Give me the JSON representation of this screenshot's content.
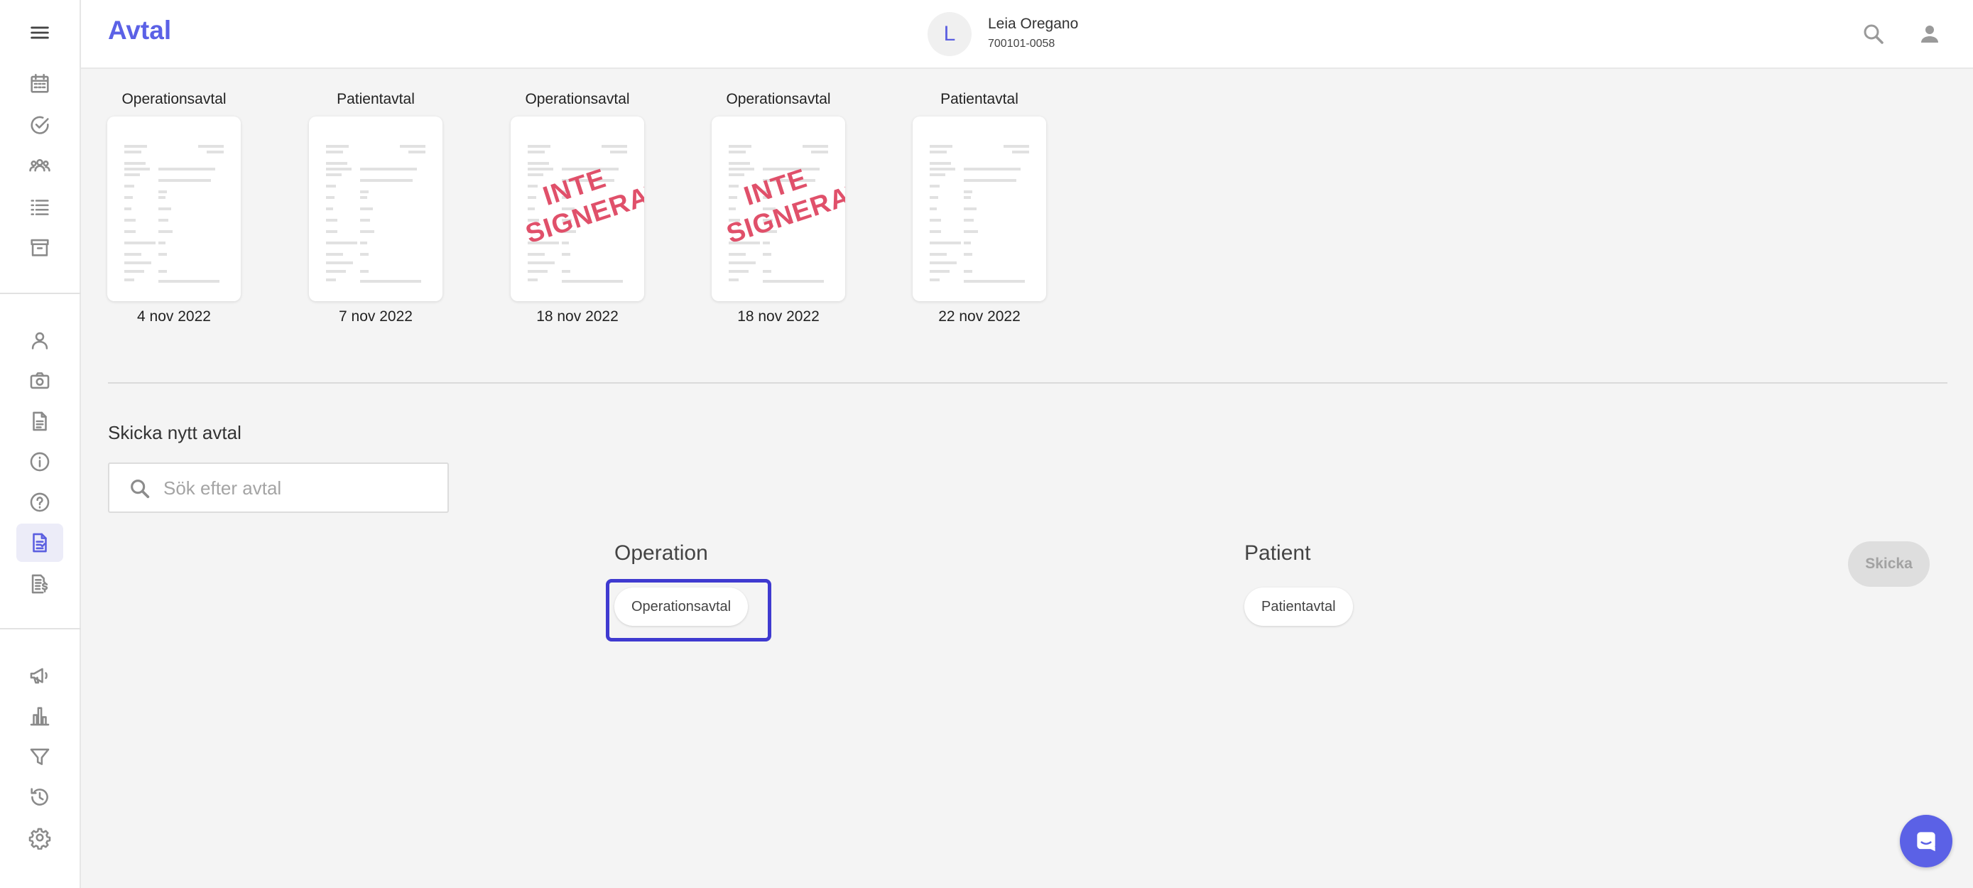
{
  "header": {
    "title": "Avtal",
    "avatar_initial": "L",
    "patient_name": "Leia Oregano",
    "patient_id": "700101-0058"
  },
  "sidebar": {
    "items": [
      {
        "icon": "menu-icon"
      },
      {
        "icon": "calendar-icon"
      },
      {
        "icon": "check-circle-icon"
      },
      {
        "icon": "group-icon"
      },
      {
        "icon": "list-icon"
      },
      {
        "icon": "archive-icon"
      },
      {
        "icon": "person-icon"
      },
      {
        "icon": "camera-icon"
      },
      {
        "icon": "document-icon"
      },
      {
        "icon": "info-icon"
      },
      {
        "icon": "help-icon"
      },
      {
        "icon": "contract-icon",
        "active": true
      },
      {
        "icon": "invoice-icon"
      },
      {
        "icon": "megaphone-icon"
      },
      {
        "icon": "bar-chart-icon"
      },
      {
        "icon": "filter-icon"
      },
      {
        "icon": "history-icon"
      },
      {
        "icon": "settings-icon"
      }
    ]
  },
  "documents": [
    {
      "label": "Operationsavtal",
      "date": "4 nov 2022",
      "stamp_line1": "",
      "stamp_line2": ""
    },
    {
      "label": "Patientavtal",
      "date": "7 nov 2022",
      "stamp_line1": "",
      "stamp_line2": ""
    },
    {
      "label": "Operationsavtal",
      "date": "18 nov 2022",
      "stamp_line1": "INTE",
      "stamp_line2": "SIGNERAT"
    },
    {
      "label": "Operationsavtal",
      "date": "18 nov 2022",
      "stamp_line1": "INTE",
      "stamp_line2": "SIGNERAT"
    },
    {
      "label": "Patientavtal",
      "date": "22 nov 2022",
      "stamp_line1": "",
      "stamp_line2": ""
    }
  ],
  "send_section": {
    "title": "Skicka nytt avtal",
    "search_placeholder": "Sök efter avtal",
    "search_value": "",
    "groups": [
      {
        "title": "Operation",
        "chips": [
          "Operationsavtal"
        ]
      },
      {
        "title": "Patient",
        "chips": [
          "Patientavtal"
        ]
      }
    ],
    "send_label": "Skicka"
  },
  "colors": {
    "accent": "#5b61e6",
    "stamp": "#e0506a",
    "highlight": "#3f3ad0"
  }
}
